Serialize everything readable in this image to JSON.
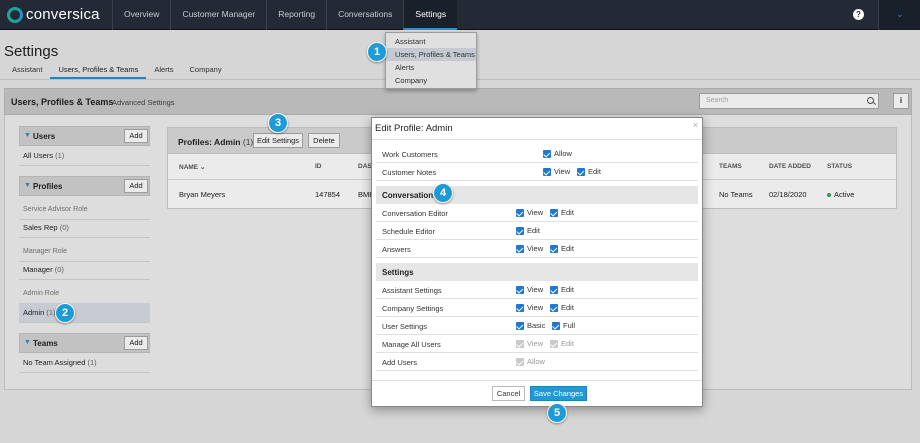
{
  "brand": {
    "name": "conversica"
  },
  "nav": {
    "items": [
      {
        "label": "Overview"
      },
      {
        "label": "Customer Manager"
      },
      {
        "label": "Reporting"
      },
      {
        "label": "Conversations"
      },
      {
        "label": "Settings"
      }
    ],
    "help": "?",
    "user_chevron": "⌄"
  },
  "settings_dropdown": {
    "items": [
      {
        "label": "Assistant"
      },
      {
        "label": "Users, Profiles & Teams"
      },
      {
        "label": "Alerts"
      },
      {
        "label": "Company"
      }
    ]
  },
  "page": {
    "title": "Settings",
    "tabs": [
      {
        "label": "Assistant"
      },
      {
        "label": "Users, Profiles & Teams"
      },
      {
        "label": "Alerts"
      },
      {
        "label": "Company"
      }
    ]
  },
  "section": {
    "title": "Users, Profiles & Teams",
    "subtitle": "Advanced Settings",
    "search_placeholder": "Search",
    "info": "i"
  },
  "left_panel": {
    "users": {
      "label": "Users",
      "add": "Add",
      "row": "All Users",
      "count": "(1)"
    },
    "profiles": {
      "label": "Profiles",
      "add": "Add",
      "rows": [
        {
          "role": "Service Advisor Role",
          "name": "Sales Rep",
          "count": "(0)"
        },
        {
          "role": "Manager Role",
          "name": "Manager",
          "count": "(0)"
        },
        {
          "role": "Admin Role",
          "name": "Admin",
          "count": "(1)"
        }
      ]
    },
    "teams": {
      "label": "Teams",
      "add": "Add",
      "row": "No Team Assigned",
      "count": "(1)"
    }
  },
  "profiles_panel": {
    "title": "Profiles: Admin",
    "count": "(1)",
    "edit_button": "Edit Settings",
    "delete_button": "Delete",
    "columns": [
      "NAME",
      "ID",
      "DAS",
      "TEAMS",
      "DATE ADDED",
      "STATUS"
    ],
    "row": {
      "name": "Bryan Meyers",
      "id": "147854",
      "das": "BME",
      "teams": "No Teams",
      "date_added": "02/18/2020",
      "status": "Active"
    }
  },
  "modal": {
    "title": "Edit Profile: Admin",
    "close": "×",
    "top_rows": [
      {
        "name": "Work Customers",
        "opt1": "Allow"
      },
      {
        "name": "Customer Notes",
        "opt1": "View",
        "opt2": "Edit"
      }
    ],
    "conversations": {
      "title": "Conversations",
      "rows": [
        {
          "name": "Conversation Editor",
          "opt1": "View",
          "opt2": "Edit"
        },
        {
          "name": "Schedule Editor",
          "opt1": "Edit"
        },
        {
          "name": "Answers",
          "opt1": "View",
          "opt2": "Edit"
        }
      ]
    },
    "settings": {
      "title": "Settings",
      "rows": [
        {
          "name": "Assistant Settings",
          "opt1": "View",
          "opt2": "Edit"
        },
        {
          "name": "Company Settings",
          "opt1": "View",
          "opt2": "Edit"
        },
        {
          "name": "User Settings",
          "opt1": "Basic",
          "opt2": "Full"
        },
        {
          "name": "Manage All Users",
          "opt1": "View",
          "opt2": "Edit"
        },
        {
          "name": "Add Users",
          "opt1": "Allow"
        }
      ]
    },
    "cancel": "Cancel",
    "save": "Save Changes"
  },
  "callouts": [
    "1",
    "2",
    "3",
    "4",
    "5"
  ],
  "colors": {
    "accent": "#1e9ad6",
    "navbar": "#232a35",
    "checkbox": "#1f78d1",
    "active_status": "#2bb04a"
  }
}
